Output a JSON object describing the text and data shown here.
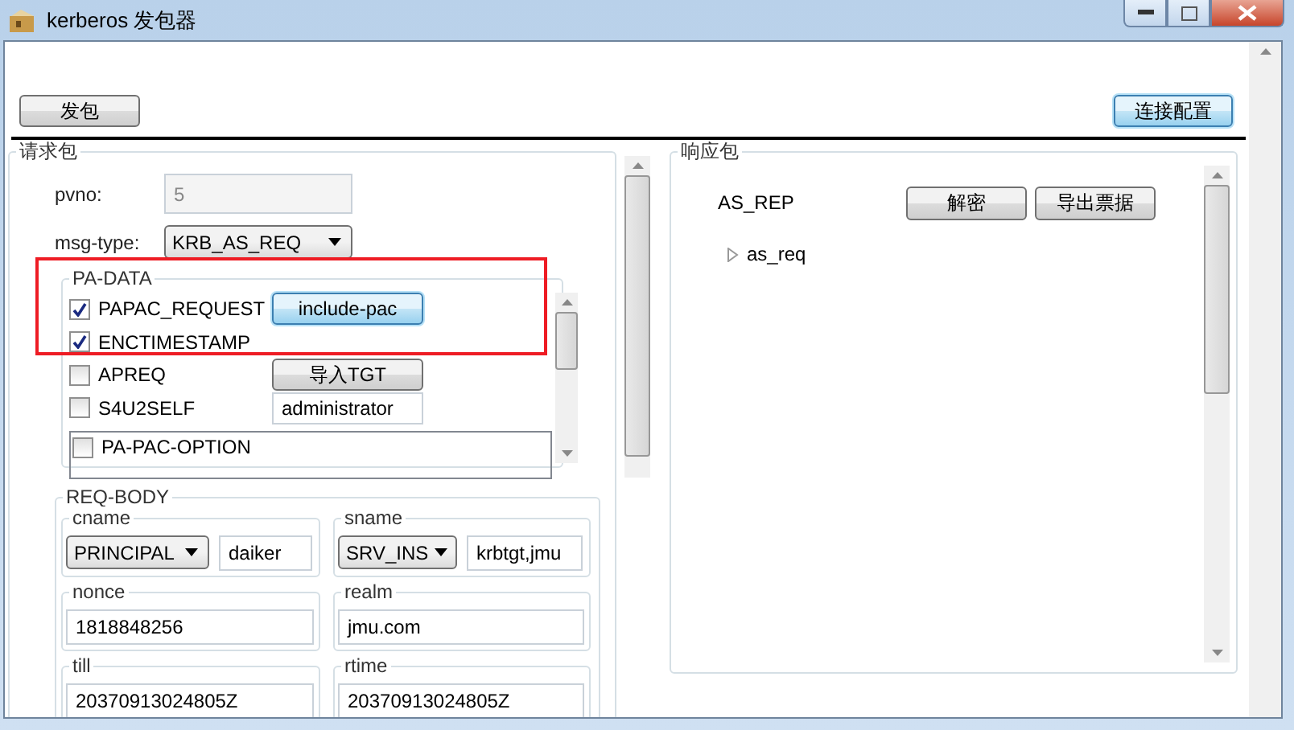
{
  "window": {
    "title": "kerberos 发包器"
  },
  "toolbar": {
    "send_button": "发包",
    "config_button": {
      "label": "连接配置",
      "focused": true
    }
  },
  "request": {
    "title": "请求包",
    "pvno": {
      "label": "pvno:",
      "value": "5",
      "disabled": true
    },
    "msg_type": {
      "label": "msg-type:",
      "value": "KRB_AS_REQ"
    },
    "pa_data": {
      "title": "PA-DATA",
      "items": [
        {
          "label": "PAPAC_REQUEST",
          "checked": true,
          "control": {
            "kind": "button",
            "text": "include-pac",
            "focused": true
          }
        },
        {
          "label": "ENCTIMESTAMP",
          "checked": true
        },
        {
          "label": "APREQ",
          "checked": false,
          "control": {
            "kind": "button",
            "text": "导入TGT",
            "focused": false
          }
        },
        {
          "label": "S4U2SELF",
          "checked": false,
          "control": {
            "kind": "field",
            "text": "administrator"
          }
        }
      ],
      "pac_option": {
        "label": "PA-PAC-OPTION",
        "checked": false
      }
    },
    "req_body": {
      "title": "REQ-BODY",
      "cname": {
        "label": "cname",
        "type": "PRINCIPAL",
        "value": "daiker"
      },
      "sname": {
        "label": "sname",
        "type": "SRV_INS",
        "value": "krbtgt,jmu"
      },
      "fields": [
        {
          "label": "nonce",
          "value": "1818848256"
        },
        {
          "label": "realm",
          "value": "jmu.com"
        },
        {
          "label": "till",
          "value": "20370913024805Z"
        },
        {
          "label": "rtime",
          "value": "20370913024805Z"
        }
      ]
    }
  },
  "response": {
    "title": "响应包",
    "type": "AS_REP",
    "buttons": [
      "解密",
      "导出票据"
    ],
    "tree": [
      {
        "label": "as_req",
        "expanded": false
      }
    ]
  }
}
